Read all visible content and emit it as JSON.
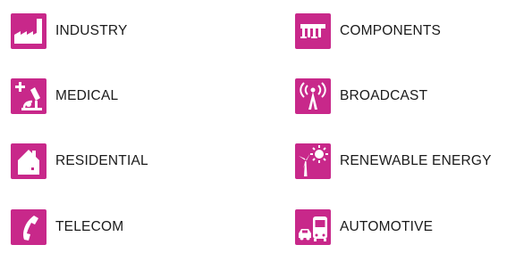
{
  "accent_color": "#c8288a",
  "categories": [
    {
      "label": "INDUSTRY",
      "icon": "factory-icon"
    },
    {
      "label": "MEDICAL",
      "icon": "microscope-icon"
    },
    {
      "label": "RESIDENTIAL",
      "icon": "house-icon"
    },
    {
      "label": "TELECOM",
      "icon": "phone-handset-icon"
    },
    {
      "label": "COMPONENTS",
      "icon": "chip-icon"
    },
    {
      "label": "BROADCAST",
      "icon": "antenna-icon"
    },
    {
      "label": "RENEWABLE ENERGY",
      "icon": "wind-sun-icon"
    },
    {
      "label": "AUTOMOTIVE",
      "icon": "vehicles-icon"
    }
  ]
}
